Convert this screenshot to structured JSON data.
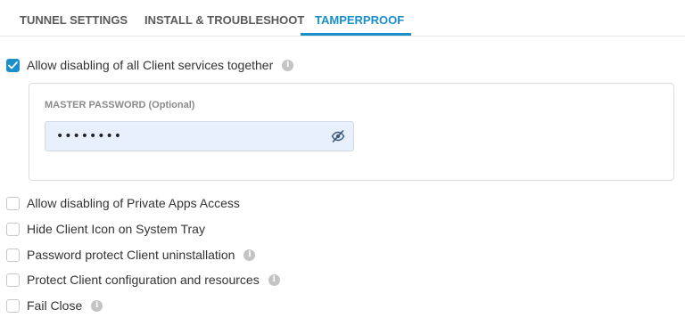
{
  "tabs": [
    {
      "label": "TUNNEL SETTINGS",
      "active": false
    },
    {
      "label": "INSTALL & TROUBLESHOOT",
      "active": false
    },
    {
      "label": "TAMPERPROOF",
      "active": true
    }
  ],
  "colors": {
    "accent": "#1a8fc9",
    "info_icon": "#c4c4c4",
    "input_bg": "#e8f0fe"
  },
  "main_option": {
    "label": "Allow disabling of all Client services together",
    "checked": true,
    "has_info": true,
    "icon": "info-icon"
  },
  "password": {
    "label": "MASTER PASSWORD (Optional)",
    "value": "••••••••",
    "toggle_icon": "eye-slash-icon"
  },
  "options": [
    {
      "label": "Allow disabling of Private Apps Access",
      "checked": false,
      "has_info": false
    },
    {
      "label": "Hide Client Icon on System Tray",
      "checked": false,
      "has_info": false
    },
    {
      "label": "Password protect Client uninstallation",
      "checked": false,
      "has_info": true
    },
    {
      "label": "Protect Client configuration and resources",
      "checked": false,
      "has_info": true
    },
    {
      "label": "Fail Close",
      "checked": false,
      "has_info": true
    }
  ]
}
